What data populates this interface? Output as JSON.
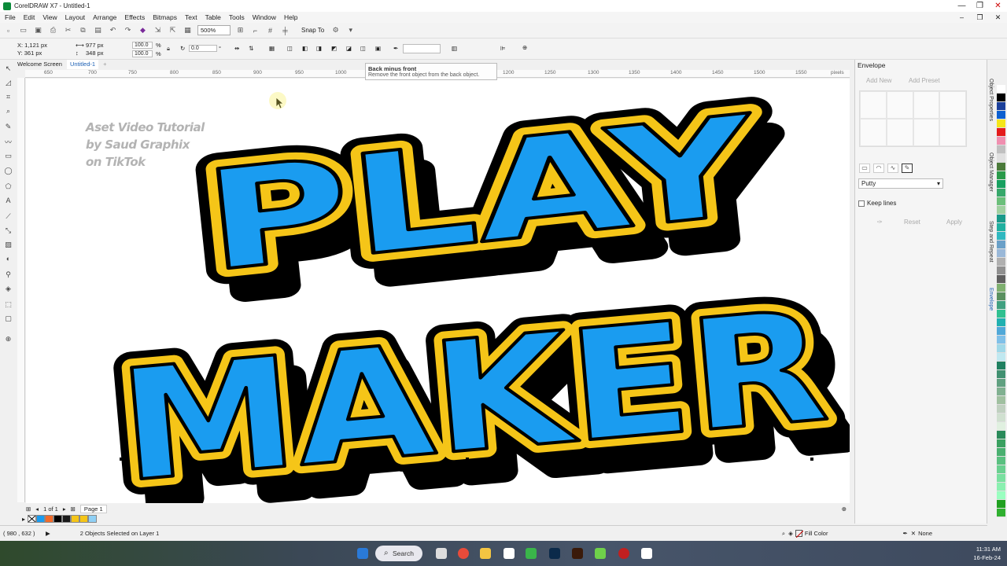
{
  "window": {
    "title": "CorelDRAW X7 - Untitled-1",
    "minimize": "—",
    "restore": "❐",
    "close": "✕"
  },
  "menu": [
    "File",
    "Edit",
    "View",
    "Layout",
    "Arrange",
    "Effects",
    "Bitmaps",
    "Text",
    "Table",
    "Tools",
    "Window",
    "Help"
  ],
  "standard_bar": {
    "zoom": "500%",
    "snap_to": "Snap To"
  },
  "property_bar": {
    "x": "X: 1,121 px",
    "y": "Y: 361 px",
    "w": "977 px",
    "h": "348 px",
    "sx": "100.0",
    "sy": "100.0",
    "pct": "%",
    "angle": "0.0",
    "deg": "°"
  },
  "tooltip": {
    "title": "Back minus front",
    "desc": "Remove the front object from the back object."
  },
  "doc_tabs": [
    "Welcome Screen",
    "Untitled-1"
  ],
  "ruler_labels": [
    "650",
    "700",
    "750",
    "800",
    "850",
    "900",
    "950",
    "1000",
    "1200",
    "1250",
    "1300",
    "1350",
    "1400",
    "1450",
    "1500",
    "1550",
    "pixels"
  ],
  "watermark": [
    "Aset Video Tutorial",
    "by Saud Graphix",
    "on TikTok"
  ],
  "artwork": {
    "line1": "PLAY",
    "line2": "MAKER",
    "fill": "#1a9cf0",
    "outline": "#000000",
    "border": "#f5c518",
    "shadow": "#f26b2a"
  },
  "page_nav": {
    "count": "1 of 1",
    "page": "Page 1"
  },
  "status": {
    "coords": "( 980 , 632 )",
    "selection": "2 Objects Selected on Layer 1",
    "fill": "Fill Color",
    "outline": "None"
  },
  "docker": {
    "title": "Envelope",
    "add_new": "Add New",
    "add_preset": "Add Preset",
    "mode": "Putty",
    "keep_lines": "Keep lines",
    "reset": "Reset",
    "apply": "Apply"
  },
  "vertical_tabs": [
    "Object Properties",
    "Object Manager",
    "Step and Repeat",
    "Envelope"
  ],
  "palette_bottom": [
    "#ffffff",
    "#1a9cf0",
    "#f26b2a",
    "#000000",
    "#1a1a1a",
    "#f5c518",
    "#f5c518",
    "#8fd0f5"
  ],
  "palette_right": [
    "#ffffff",
    "#000000",
    "#1b3f9a",
    "#0c5fd0",
    "#f5e61a",
    "#e41b1b",
    "#f08fb0",
    "#c0c0c0",
    "#e0e0e0",
    "#4b7a3a",
    "#2a9a4a",
    "#18a060",
    "#36a86a",
    "#6bbf7a",
    "#a0d0a0",
    "#1a9a8a",
    "#20b0a0",
    "#30b8c0",
    "#6aa0c8",
    "#9ab8d8",
    "#b0b0b0",
    "#909090",
    "#606060",
    "#7fb070",
    "#5a9060",
    "#40a080",
    "#30c090",
    "#20b0b0",
    "#50a8d8",
    "#80c0e8",
    "#a0d8e8",
    "#c0e8f0",
    "#208060",
    "#409070",
    "#60a080",
    "#80b090",
    "#a0c0a0",
    "#c0d0c0",
    "#d0e0d0",
    "#e0f0e0",
    "#2a8a5a",
    "#3aa060",
    "#4ab070",
    "#5ac080",
    "#6ad090",
    "#7ae0a0",
    "#8af0b0",
    "#9affc0",
    "#20a020",
    "#30b030"
  ],
  "taskbar": {
    "search": "Search",
    "time": "11:31 AM",
    "date": "16-Feb-24"
  }
}
